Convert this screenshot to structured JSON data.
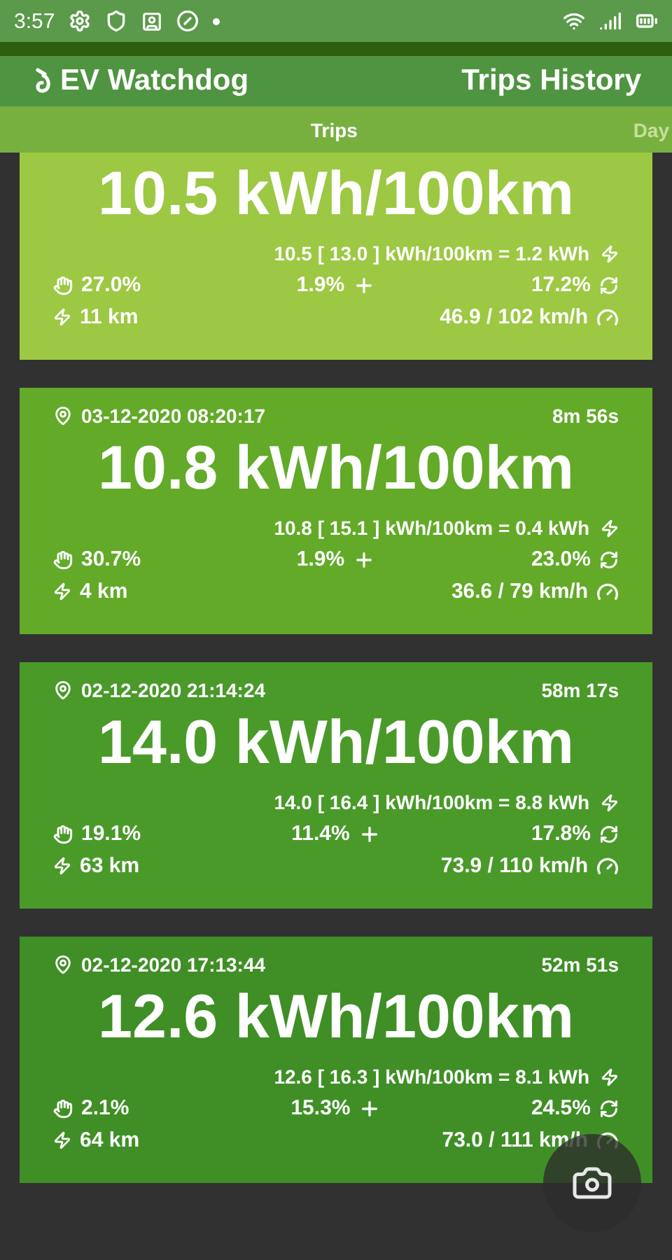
{
  "status_bar": {
    "time": "3:57"
  },
  "app_bar": {
    "app_name": "EV Watchdog",
    "screen_title": "Trips History"
  },
  "tabs": [
    {
      "label": "Trips",
      "selected": true
    },
    {
      "label": "Day",
      "selected": false
    }
  ],
  "trips": [
    {
      "color": "#9dc843",
      "consumption": "10.5 kWh/100km",
      "detail": "10.5 [ 13.0 ] kWh/100km = 1.2 kWh",
      "share_1": "27.0%",
      "share_2": "1.9%",
      "share_3": "17.2%",
      "distance": "11 km",
      "speed": "46.9 / 102 km/h"
    },
    {
      "color": "#62aa28",
      "date": "03-12-2020 08:20:17",
      "duration": "8m 56s",
      "consumption": "10.8 kWh/100km",
      "detail": "10.8 [ 15.1 ] kWh/100km = 0.4 kWh",
      "share_1": "30.7%",
      "share_2": "1.9%",
      "share_3": "23.0%",
      "distance": "4 km",
      "speed": "36.6 / 79 km/h"
    },
    {
      "color": "#4a9a2a",
      "date": "02-12-2020 21:14:24",
      "duration": "58m 17s",
      "consumption": "14.0 kWh/100km",
      "detail": "14.0 [ 16.4 ] kWh/100km = 8.8 kWh",
      "share_1": "19.1%",
      "share_2": "11.4%",
      "share_3": "17.8%",
      "distance": "63 km",
      "speed": "73.9 / 110 km/h"
    },
    {
      "color": "#3f8f26",
      "date": "02-12-2020 17:13:44",
      "duration": "52m 51s",
      "consumption": "12.6 kWh/100km",
      "detail": "12.6 [ 16.3 ] kWh/100km = 8.1 kWh",
      "share_1": "2.1%",
      "share_2": "15.3%",
      "share_3": "24.5%",
      "distance": "64 km",
      "speed": "73.0 / 111 km/h"
    }
  ]
}
